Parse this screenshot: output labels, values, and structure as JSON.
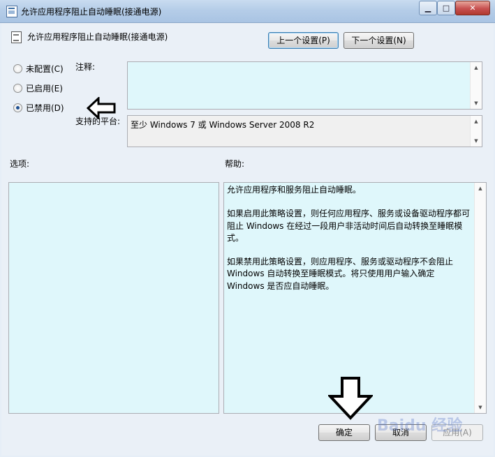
{
  "window": {
    "title": "允许应用程序阻止自动睡眠(接通电源)",
    "controls": {
      "minimize": "▁",
      "maximize": "□",
      "close": "✕"
    }
  },
  "header": {
    "title": "允许应用程序阻止自动睡眠(接通电源)",
    "prev_label": "上一个设置(P)",
    "next_label": "下一个设置(N)"
  },
  "state": {
    "options": [
      {
        "label": "未配置(C)",
        "checked": false
      },
      {
        "label": "已启用(E)",
        "checked": false
      },
      {
        "label": "已禁用(D)",
        "checked": true
      }
    ]
  },
  "comment": {
    "label": "注释:",
    "value": ""
  },
  "platform": {
    "label": "支持的平台:",
    "value": "至少 Windows 7 或 Windows Server 2008 R2"
  },
  "options_panel": {
    "label": "选项:"
  },
  "help": {
    "label": "帮助:",
    "paragraphs": [
      "允许应用程序和服务阻止自动睡眠。",
      "如果启用此策略设置，则任何应用程序、服务或设备驱动程序都可阻止 Windows 在经过一段用户非活动时间后自动转换至睡眠模式。",
      "如果禁用此策略设置，则应用程序、服务或驱动程序不会阻止 Windows 自动转换至睡眠模式。将只使用用户输入确定 Windows 是否应自动睡眠。"
    ]
  },
  "footer": {
    "ok_label": "确定",
    "cancel_label": "取消",
    "apply_label": "应用(A)"
  },
  "watermark": "Baidu 经验",
  "colors": {
    "panel_bg": "#dff7fb",
    "titlebar": "#b5cde8",
    "close_button": "#c75050"
  }
}
